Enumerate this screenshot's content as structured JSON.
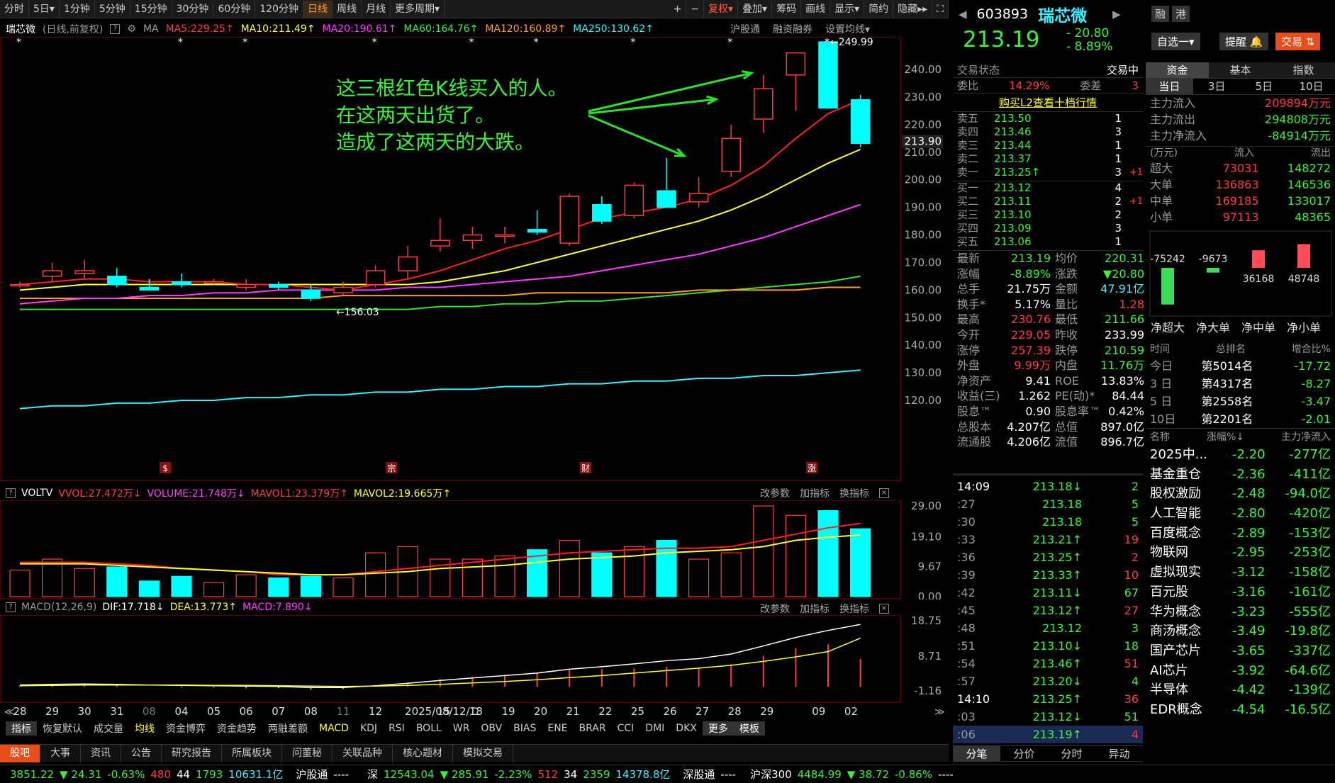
{
  "toolbar": {
    "items": [
      "分时",
      "5日▾",
      "1分钟",
      "5分钟",
      "15分钟",
      "30分钟",
      "60分钟",
      "120分钟",
      "日线",
      "周线",
      "月线",
      "更多周期▾"
    ],
    "active": "日线",
    "right": [
      "+",
      "−",
      "复权▾",
      "叠加▾",
      "筹码",
      "画线",
      "显示▾",
      "简约",
      "隐藏▸▸"
    ]
  },
  "stock": {
    "name": "瑞芯微",
    "code": "603893",
    "mode": "(日线,前复权)"
  },
  "ma": {
    "label": "MA",
    "ma5": "MA5:229.25↑",
    "ma10": "MA10:211.49↑",
    "ma20": "MA20:190.61↑",
    "ma60": "MA60:164.76↑",
    "ma120": "MA120:160.89↑",
    "ma250": "MA250:130.62↑",
    "hgt": "沪股通",
    "rzrq": "融资融券",
    "setma": "设置均线▾"
  },
  "annotation": {
    "l1": "这三根红色K线买入的人。",
    "l2": "在这两天出货了。",
    "l3": "造成了这两天的大跌。"
  },
  "price_axis": [
    "240.00",
    "230.00",
    "220.00",
    "210.00",
    "200.00",
    "190.00",
    "180.00",
    "170.00",
    "160.00",
    "150.00",
    "140.00",
    "130.00",
    "120.00"
  ],
  "current_price_label": "213.90",
  "high_mark": "249.99",
  "low_mark": "156.03",
  "markers": [
    "$",
    "宗",
    "财",
    "涨"
  ],
  "vol": {
    "title": "VOLTV",
    "vvol": "VVOL:27.472万↓",
    "volume": "VOLUME:21.748万↓",
    "mavol1": "MAVOL1:23.379万↑",
    "mavol2": "MAVOL2:19.665万↑",
    "axis": [
      "29.00",
      "19.10",
      "9.67",
      "0.00"
    ],
    "btns": [
      "改参数",
      "加指标",
      "换指标"
    ]
  },
  "macd": {
    "title": "MACD(12,26,9)",
    "dif": "DIF:17.718↓",
    "dea": "DEA:13.773↑",
    "macd": "MACD:7.890↓",
    "axis": [
      "18.75",
      "8.71",
      "-1.16"
    ]
  },
  "dates": [
    "28",
    "29",
    "30",
    "31",
    "08",
    "04",
    "05",
    "06",
    "07",
    "08",
    "11",
    "12",
    "2025/08/12/二",
    "15",
    "18",
    "19",
    "20",
    "21",
    "22",
    "25",
    "26",
    "27",
    "28",
    "29",
    "09",
    "02"
  ],
  "indicator_tabs": [
    "指标",
    "恢复默认",
    "成交量",
    "均线",
    "资金博弈",
    "资金趋势",
    "两融差额",
    "MACD",
    "KDJ",
    "RSI",
    "BOLL",
    "WR",
    "OBV",
    "BIAS",
    "ENE",
    "BRAR",
    "CCI",
    "DMI",
    "DKX",
    "更多",
    "模板"
  ],
  "bottom_tabs": [
    "股吧",
    "大事",
    "资讯",
    "公告",
    "研究报告",
    "所属板块",
    "问董秘",
    "关联品种",
    "核心题材",
    "模拟交易"
  ],
  "quote": {
    "price": "213.19",
    "change": "- 20.80",
    "pct": "- 8.89%",
    "rong": "融",
    "gang": "港",
    "zixuan": "自选一▾",
    "tixing": "提醒 🔔",
    "jiaoyi": "交易 ⇅"
  },
  "trade_status": {
    "label": "交易状态",
    "value": "交易中",
    "wb": "委比",
    "wb_v": "14.29%",
    "wc": "委差",
    "wc_v": "3",
    "l2": "购买L2查看十档行情"
  },
  "asks": [
    [
      "卖五",
      "213.50",
      "1",
      ""
    ],
    [
      "卖四",
      "213.46",
      "3",
      ""
    ],
    [
      "卖三",
      "213.44",
      "1",
      ""
    ],
    [
      "卖二",
      "213.37",
      "1",
      ""
    ],
    [
      "卖一",
      "213.25↑",
      "3",
      "+1"
    ]
  ],
  "bids": [
    [
      "买一",
      "213.12",
      "4",
      ""
    ],
    [
      "买二",
      "213.11",
      "2",
      "+1"
    ],
    [
      "买三",
      "213.10",
      "2",
      ""
    ],
    [
      "买四",
      "213.09",
      "3",
      ""
    ],
    [
      "买五",
      "213.06",
      "1",
      ""
    ]
  ],
  "stats": [
    [
      "最新",
      "213.19",
      "均价",
      "220.31"
    ],
    [
      "涨幅",
      "-8.89%",
      "涨跌",
      "▼20.80"
    ],
    [
      "总手",
      "21.75万",
      "金额",
      "47.91亿"
    ],
    [
      "换手*",
      "5.17%",
      "量比",
      "1.28"
    ],
    [
      "最高",
      "230.76",
      "最低",
      "211.66"
    ],
    [
      "今开",
      "229.05",
      "昨收",
      "233.99"
    ],
    [
      "涨停",
      "257.39",
      "跌停",
      "210.59"
    ],
    [
      "外盘",
      "9.99万",
      "内盘",
      "11.76万"
    ],
    [
      "净资产",
      "9.41",
      "ROE",
      "13.83%"
    ],
    [
      "收益(三)",
      "1.262",
      "PE(动)*",
      "84.44"
    ],
    [
      "股息™",
      "0.90",
      "股息率™",
      "0.42%"
    ],
    [
      "总股本",
      "4.207亿",
      "总值",
      "897.0亿"
    ],
    [
      "流通股",
      "4.206亿",
      "流值",
      "896.7亿"
    ]
  ],
  "ticks": [
    [
      "14:09",
      "213.18↓",
      "2"
    ],
    [
      ":27",
      "213.18",
      "5"
    ],
    [
      ":30",
      "213.18",
      "5"
    ],
    [
      ":33",
      "213.21↑",
      "19"
    ],
    [
      ":36",
      "213.25↑",
      "2"
    ],
    [
      ":39",
      "213.33↑",
      "10"
    ],
    [
      ":42",
      "213.11↓",
      "67"
    ],
    [
      ":45",
      "213.12↑",
      "27"
    ],
    [
      ":48",
      "213.12",
      "3"
    ],
    [
      ":51",
      "213.10↓",
      "18"
    ],
    [
      ":54",
      "213.46↑",
      "51"
    ],
    [
      ":57",
      "213.20↓",
      "4"
    ],
    [
      "14:10",
      "213.25↑",
      "36"
    ],
    [
      ":03",
      "213.12↓",
      "51"
    ],
    [
      ":06",
      "213.19↑",
      "4"
    ]
  ],
  "tick_tabs": [
    "分笔",
    "分价",
    "分时",
    "异动"
  ],
  "fund_tabs": [
    "资金",
    "基本",
    "指数"
  ],
  "period_tabs": [
    "当日",
    "3日",
    "5日",
    "10日"
  ],
  "flow": [
    [
      "主力流入",
      "209894万元"
    ],
    [
      "主力流出",
      "294808万元"
    ],
    [
      "主力净流入",
      "-84914万元"
    ]
  ],
  "flow_head": [
    "(万元)",
    "流入",
    "流出"
  ],
  "flow_table": [
    [
      "超大",
      "73031",
      "148272"
    ],
    [
      "大单",
      "136863",
      "146536"
    ],
    [
      "中单",
      "169185",
      "133017"
    ],
    [
      "小单",
      "97113",
      "48365"
    ]
  ],
  "net_bars": {
    "labels": [
      "净超大",
      "净大单",
      "净中单",
      "净小单"
    ],
    "values": [
      -75242,
      -9673,
      36168,
      48748
    ],
    "texts": [
      "-75242",
      "-9673",
      "36168",
      "48748"
    ]
  },
  "rank_head": [
    "时间",
    "总排名",
    "增合比%"
  ],
  "rank": [
    [
      "今日",
      "第5014名",
      "-17.72"
    ],
    [
      "3 日",
      "第4317名",
      "-8.27"
    ],
    [
      "5 日",
      "第2558名",
      "-3.47"
    ],
    [
      "10日",
      "第2201名",
      "-2.01"
    ]
  ],
  "sector_head": [
    "名称",
    "涨幅%↓",
    "主力净流入"
  ],
  "sectors": [
    [
      "2025中...",
      "-2.20",
      "-277亿"
    ],
    [
      "基金重仓",
      "-2.36",
      "-411亿"
    ],
    [
      "股权激励",
      "-2.48",
      "-94.0亿"
    ],
    [
      "人工智能",
      "-2.80",
      "-420亿"
    ],
    [
      "百度概念",
      "-2.89",
      "-153亿"
    ],
    [
      "物联网",
      "-2.95",
      "-253亿"
    ],
    [
      "虚拟现实",
      "-3.12",
      "-158亿"
    ],
    [
      "百元股",
      "-3.16",
      "-161亿"
    ],
    [
      "华为概念",
      "-3.23",
      "-555亿"
    ],
    [
      "商汤概念",
      "-3.49",
      "-19.8亿"
    ],
    [
      "国产芯片",
      "-3.65",
      "-337亿"
    ],
    [
      "AI芯片",
      "-3.92",
      "-64.6亿"
    ],
    [
      "半导体",
      "-4.42",
      "-139亿"
    ],
    [
      "EDR概念",
      "-4.54",
      "-16.5亿"
    ]
  ],
  "status_bar": {
    "sh": "3851.22",
    "sh_chg": "▼ 24.31",
    "sh_pct": "-0.63%",
    "sh_up": "480",
    "sh_flat": "44",
    "sh_dn": "1793",
    "sh_amt": "10631.1亿",
    "hgt": "沪股通",
    "hgt_v": "----",
    "sz_label": "深",
    "sz": "12543.04",
    "sz_chg": "▼ 285.91",
    "sz_pct": "-2.23%",
    "sz_up": "512",
    "sz_flat": "34",
    "sz_dn": "2359",
    "sz_amt": "14378.8亿",
    "sgt": "深股通",
    "sgt_v": "----",
    "hs300": "沪深300",
    "hs300_v": "4484.99",
    "hs300_chg": "▼ 38.72",
    "hs300_pct": "-0.86%",
    "extra": "----"
  },
  "chart_data": {
    "type": "candlestick",
    "ylim": [
      115,
      250
    ],
    "candles": [
      [
        162,
        163,
        161,
        162
      ],
      [
        165,
        170,
        163,
        167
      ],
      [
        166,
        171,
        164,
        167
      ],
      [
        165,
        168,
        161,
        162
      ],
      [
        161,
        164,
        160,
        160
      ],
      [
        163,
        166,
        161,
        162
      ],
      [
        163,
        164,
        162,
        163
      ],
      [
        161,
        164,
        160,
        162
      ],
      [
        162,
        163,
        160,
        161
      ],
      [
        160,
        162,
        156.03,
        157
      ],
      [
        159,
        163,
        158,
        161
      ],
      [
        162,
        169,
        161,
        167
      ],
      [
        167,
        176,
        164,
        172
      ],
      [
        176,
        186,
        174,
        178
      ],
      [
        178,
        183,
        175,
        180
      ],
      [
        180,
        183,
        177,
        180
      ],
      [
        182,
        189,
        180,
        181
      ],
      [
        177,
        195,
        176,
        194
      ],
      [
        191,
        194,
        184,
        185
      ],
      [
        187,
        199,
        186,
        198
      ],
      [
        196,
        208,
        193,
        190
      ],
      [
        192,
        201,
        190,
        195
      ],
      [
        203,
        220,
        201,
        215
      ],
      [
        222,
        238,
        217,
        233
      ],
      [
        238,
        246,
        225,
        246
      ],
      [
        249.99,
        249.99,
        226,
        226
      ],
      [
        229,
        230.76,
        211.66,
        213.19
      ]
    ],
    "ma5": [
      162,
      163,
      164,
      164,
      163,
      163,
      163,
      162,
      162,
      161,
      160,
      162,
      164,
      167,
      171,
      175,
      178,
      182,
      186,
      188,
      190,
      193,
      198,
      205,
      215,
      224,
      229
    ],
    "ma10": [
      160,
      161,
      162,
      162,
      162,
      162,
      162,
      162,
      162,
      162,
      162,
      162,
      162,
      163,
      165,
      167,
      170,
      173,
      176,
      179,
      182,
      185,
      189,
      194,
      200,
      206,
      211
    ],
    "ma20": [
      155,
      156,
      157,
      157,
      158,
      158,
      159,
      159,
      160,
      160,
      160,
      160,
      161,
      161,
      162,
      163,
      164,
      165,
      167,
      169,
      171,
      173,
      176,
      179,
      183,
      187,
      191
    ],
    "ma60": [
      153,
      153,
      153,
      153,
      153,
      153,
      153,
      153,
      153,
      153,
      153,
      153,
      153,
      154,
      154,
      155,
      155,
      156,
      156,
      157,
      158,
      159,
      160,
      161,
      162,
      163,
      165
    ],
    "ma120": [
      157,
      157,
      157,
      157,
      157,
      157,
      157,
      157,
      157,
      157,
      158,
      158,
      158,
      158,
      158,
      158,
      159,
      159,
      159,
      159,
      159,
      160,
      160,
      160,
      160,
      161,
      161
    ],
    "ma250": [
      117,
      118,
      118,
      119,
      119,
      120,
      120,
      121,
      121,
      122,
      122,
      123,
      123,
      124,
      124,
      125,
      125,
      126,
      126,
      127,
      127,
      128,
      128,
      129,
      129,
      130,
      131
    ],
    "volume": [
      8.5,
      12,
      9,
      9.5,
      5,
      6.5,
      4.5,
      7,
      6,
      6.5,
      6,
      14,
      16,
      12,
      12,
      13,
      15,
      18,
      14,
      16,
      18,
      12,
      14,
      29,
      26,
      27.5,
      21.7
    ],
    "mavol1": [
      11,
      11,
      11,
      10.5,
      10,
      9,
      8.5,
      8,
      7,
      7,
      7,
      8,
      9,
      10,
      11,
      12,
      13,
      14,
      14.5,
      15,
      15.5,
      15.5,
      16,
      18,
      20,
      22,
      23.4
    ],
    "mavol2": [
      10.5,
      10.5,
      10.5,
      10,
      9.5,
      9,
      8.5,
      8,
      7.5,
      7,
      7,
      7.5,
      8,
      9,
      9.5,
      10,
      11,
      12,
      12.5,
      13,
      14,
      14.5,
      15,
      16,
      18,
      19,
      19.7
    ],
    "dif": [
      0.5,
      0.7,
      0.8,
      0.7,
      0.5,
      0.4,
      0.3,
      0.2,
      0.1,
      -0.2,
      -0.2,
      0.3,
      1,
      1.8,
      2.5,
      3.2,
      3.9,
      5,
      5.7,
      6.5,
      7.4,
      8,
      9.3,
      11.6,
      14,
      16,
      17.7
    ],
    "dea": [
      0.3,
      0.4,
      0.5,
      0.5,
      0.5,
      0.5,
      0.4,
      0.4,
      0.3,
      0.2,
      0.1,
      0.2,
      0.4,
      0.7,
      1.1,
      1.5,
      2,
      2.6,
      3.2,
      3.9,
      4.6,
      5.3,
      6.1,
      7.2,
      8.5,
      10,
      13.8
    ],
    "macd": [
      0.4,
      0.6,
      0.6,
      0.4,
      0,
      -0.2,
      -0.2,
      -0.4,
      -0.4,
      -0.8,
      -0.6,
      0.2,
      1.2,
      2.2,
      2.8,
      3.4,
      3.8,
      4.8,
      5,
      5.2,
      5.6,
      5.4,
      6.4,
      8.8,
      11,
      12,
      7.9
    ]
  }
}
